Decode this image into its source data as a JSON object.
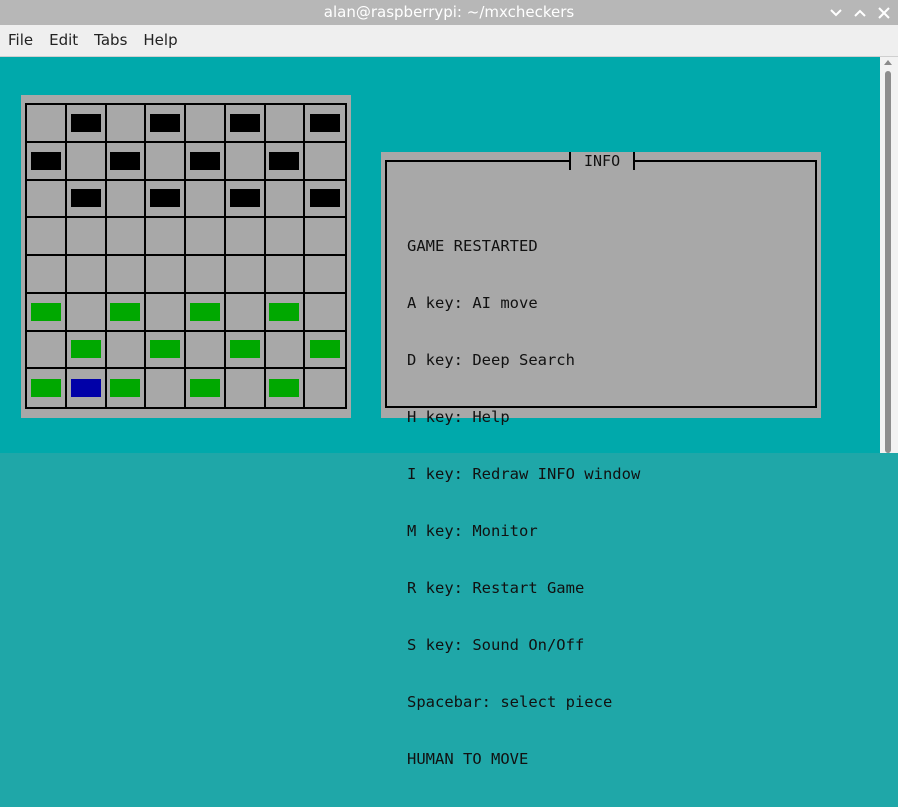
{
  "window": {
    "title": "alan@raspberrypi: ~/mxcheckers"
  },
  "menubar": {
    "items": [
      "File",
      "Edit",
      "Tabs",
      "Help"
    ]
  },
  "board": {
    "rows": [
      [
        "",
        "black",
        "",
        "black",
        "",
        "black",
        "",
        "black"
      ],
      [
        "black",
        "",
        "black",
        "",
        "black",
        "",
        "black",
        ""
      ],
      [
        "",
        "black",
        "",
        "black",
        "",
        "black",
        "",
        "black"
      ],
      [
        "",
        "",
        "",
        "",
        "",
        "",
        "",
        ""
      ],
      [
        "",
        "",
        "",
        "",
        "",
        "",
        "",
        ""
      ],
      [
        "green",
        "",
        "green",
        "",
        "green",
        "",
        "green",
        ""
      ],
      [
        "",
        "green",
        "",
        "green",
        "",
        "green",
        "",
        "green"
      ],
      [
        "green",
        "blue",
        "green",
        "",
        "green",
        "",
        "green",
        ""
      ]
    ]
  },
  "info": {
    "title": "INFO",
    "lines": [
      "GAME RESTARTED",
      "A key: AI move",
      "D key: Deep Search",
      "H key: Help",
      "I key: Redraw INFO window",
      "M key: Monitor",
      "R key: Restart Game",
      "S key: Sound On/Off",
      "Spacebar: select piece",
      "HUMAN TO MOVE"
    ]
  },
  "colors": {
    "terminal_bg": "#00a9ab",
    "panel_bg": "#a8a8a8",
    "black_piece": "#000000",
    "green_piece": "#00a800",
    "selected_piece": "#0000a8"
  },
  "icons": {
    "title_controls": [
      "chevron-down-icon",
      "chevron-up-icon",
      "close-icon"
    ]
  }
}
